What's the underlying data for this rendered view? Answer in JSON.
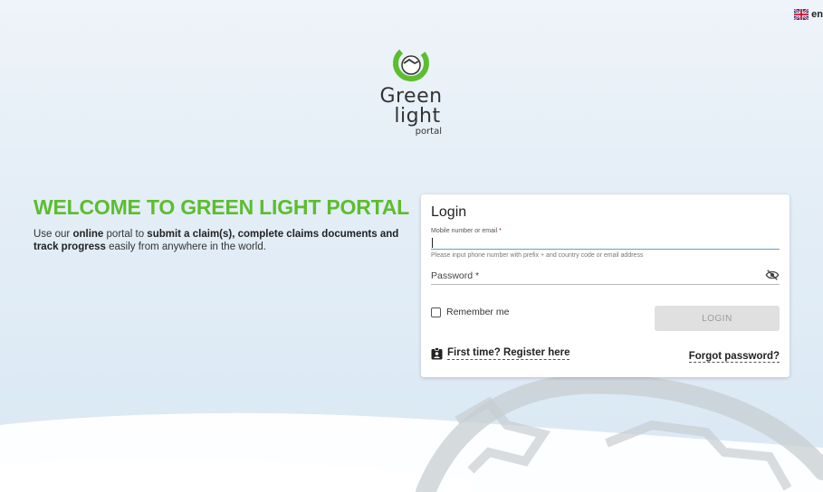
{
  "language": {
    "code": "en",
    "flag_icon": "uk-flag-icon"
  },
  "logo": {
    "line1": "Green",
    "line2": "light",
    "line3": "portal",
    "icon": "green-light-logo-icon",
    "accent": "#5cbd2e"
  },
  "welcome": {
    "title": "WELCOME TO GREEN LIGHT PORTAL",
    "text_1": "Use our ",
    "text_bold_1": "online",
    "text_2": " portal to ",
    "text_bold_2": "submit a claim(s), complete claims documents and track progress",
    "text_3": " easily from anywhere in the world."
  },
  "login": {
    "title": "Login",
    "mobile_label": "Mobile number or email",
    "required_mark": "*",
    "mobile_value": "",
    "mobile_hint": "Please input phone number with prefix + and country code or email address",
    "password_label": "Password *",
    "password_value": "",
    "eye_icon": "visibility-off-icon",
    "remember_label": "Remember me",
    "remember_checked": false,
    "login_button": "LOGIN",
    "register_icon": "contact-badge-icon",
    "register_link": "First time? Register here",
    "forgot_link": "Forgot password?"
  }
}
